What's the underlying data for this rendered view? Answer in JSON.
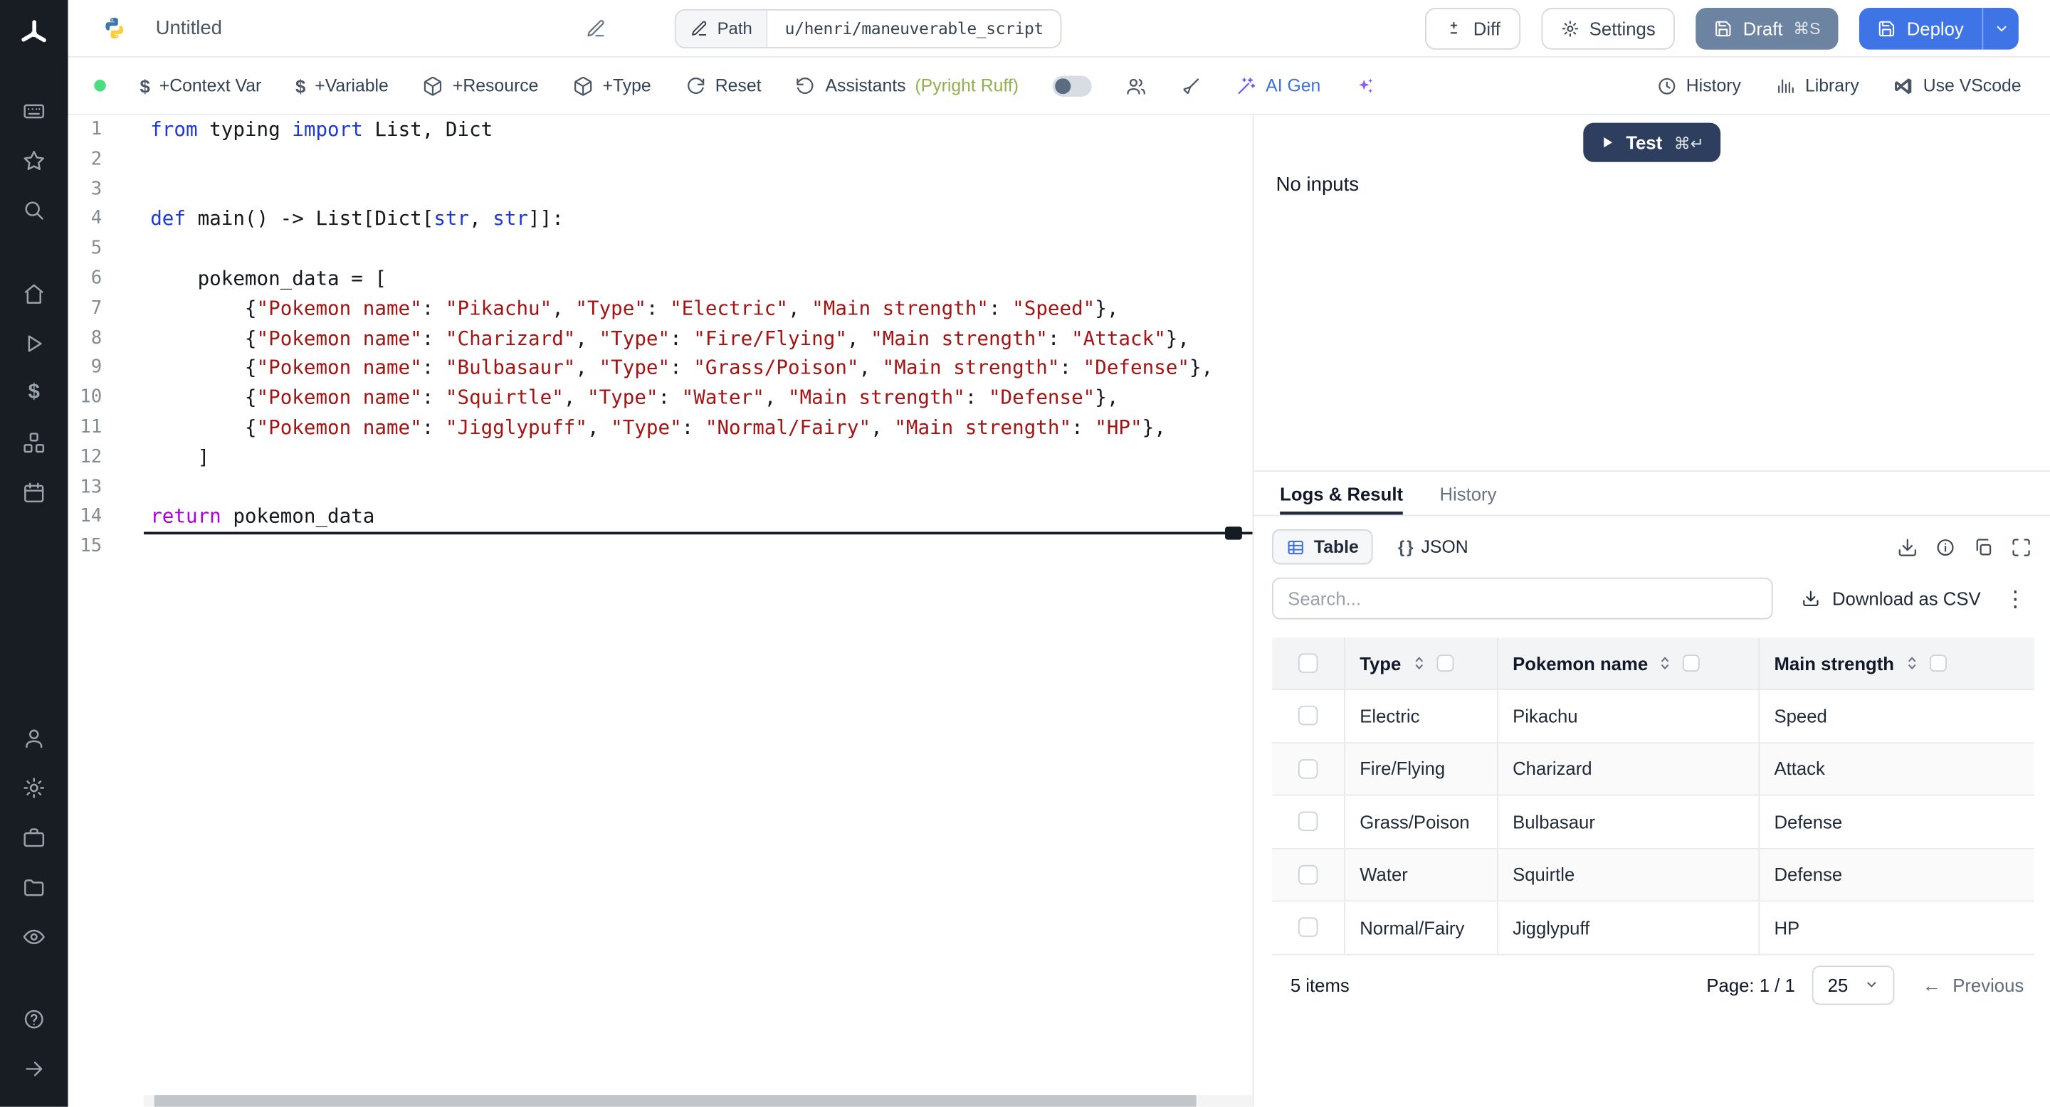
{
  "header": {
    "title": "Untitled",
    "path_label": "Path",
    "path_value": "u/henri/maneuverable_script",
    "diff": "Diff",
    "settings": "Settings",
    "draft": "Draft",
    "draft_shortcut": "⌘S",
    "deploy": "Deploy"
  },
  "toolbar": {
    "context_var": "+Context Var",
    "variable": "+Variable",
    "resource": "+Resource",
    "type": "+Type",
    "reset": "Reset",
    "assistants": "Assistants",
    "assistants_status": "(Pyright Ruff)",
    "ai_gen": "AI Gen",
    "history": "History",
    "library": "Library",
    "use_vscode": "Use VScode"
  },
  "editor": {
    "language": "python",
    "lines": [
      [
        [
          "k",
          "from"
        ],
        [
          "p",
          " typing "
        ],
        [
          "k",
          "import"
        ],
        [
          "p",
          " List, Dict"
        ]
      ],
      [],
      [],
      [
        [
          "k",
          "def"
        ],
        [
          "p",
          " main() -> List[Dict["
        ],
        [
          "t",
          "str"
        ],
        [
          "p",
          ", "
        ],
        [
          "t",
          "str"
        ],
        [
          "p",
          "]]:"
        ]
      ],
      [],
      [
        [
          "p",
          "    pokemon_data = ["
        ]
      ],
      [
        [
          "p",
          "        {"
        ],
        [
          "s",
          "\"Pokemon name\""
        ],
        [
          "p",
          ": "
        ],
        [
          "s",
          "\"Pikachu\""
        ],
        [
          "p",
          ", "
        ],
        [
          "s",
          "\"Type\""
        ],
        [
          "p",
          ": "
        ],
        [
          "s",
          "\"Electric\""
        ],
        [
          "p",
          ", "
        ],
        [
          "s",
          "\"Main strength\""
        ],
        [
          "p",
          ": "
        ],
        [
          "s",
          "\"Speed\""
        ],
        [
          "p",
          "},"
        ]
      ],
      [
        [
          "p",
          "        {"
        ],
        [
          "s",
          "\"Pokemon name\""
        ],
        [
          "p",
          ": "
        ],
        [
          "s",
          "\"Charizard\""
        ],
        [
          "p",
          ", "
        ],
        [
          "s",
          "\"Type\""
        ],
        [
          "p",
          ": "
        ],
        [
          "s",
          "\"Fire/Flying\""
        ],
        [
          "p",
          ", "
        ],
        [
          "s",
          "\"Main strength\""
        ],
        [
          "p",
          ": "
        ],
        [
          "s",
          "\"Attack\""
        ],
        [
          "p",
          "},"
        ]
      ],
      [
        [
          "p",
          "        {"
        ],
        [
          "s",
          "\"Pokemon name\""
        ],
        [
          "p",
          ": "
        ],
        [
          "s",
          "\"Bulbasaur\""
        ],
        [
          "p",
          ", "
        ],
        [
          "s",
          "\"Type\""
        ],
        [
          "p",
          ": "
        ],
        [
          "s",
          "\"Grass/Poison\""
        ],
        [
          "p",
          ", "
        ],
        [
          "s",
          "\"Main strength\""
        ],
        [
          "p",
          ": "
        ],
        [
          "s",
          "\"Defense\""
        ],
        [
          "p",
          "},"
        ]
      ],
      [
        [
          "p",
          "        {"
        ],
        [
          "s",
          "\"Pokemon name\""
        ],
        [
          "p",
          ": "
        ],
        [
          "s",
          "\"Squirtle\""
        ],
        [
          "p",
          ", "
        ],
        [
          "s",
          "\"Type\""
        ],
        [
          "p",
          ": "
        ],
        [
          "s",
          "\"Water\""
        ],
        [
          "p",
          ", "
        ],
        [
          "s",
          "\"Main strength\""
        ],
        [
          "p",
          ": "
        ],
        [
          "s",
          "\"Defense\""
        ],
        [
          "p",
          "},"
        ]
      ],
      [
        [
          "p",
          "        {"
        ],
        [
          "s",
          "\"Pokemon name\""
        ],
        [
          "p",
          ": "
        ],
        [
          "s",
          "\"Jigglypuff\""
        ],
        [
          "p",
          ", "
        ],
        [
          "s",
          "\"Type\""
        ],
        [
          "p",
          ": "
        ],
        [
          "s",
          "\"Normal/Fairy\""
        ],
        [
          "p",
          ", "
        ],
        [
          "s",
          "\"Main strength\""
        ],
        [
          "p",
          ": "
        ],
        [
          "s",
          "\"HP\""
        ],
        [
          "p",
          "},"
        ]
      ],
      [
        [
          "p",
          "    ]"
        ]
      ],
      [],
      [
        [
          "r",
          "return"
        ],
        [
          "p",
          " pokemon_data"
        ]
      ],
      []
    ]
  },
  "run": {
    "test": "Test",
    "test_shortcut": "⌘↵",
    "no_inputs": "No inputs"
  },
  "results": {
    "tabs": [
      "Logs & Result",
      "History"
    ],
    "active_tab": "Logs & Result",
    "views": {
      "table": "Table",
      "json": "JSON"
    },
    "search_placeholder": "Search...",
    "download_csv": "Download as CSV",
    "table": {
      "columns": [
        "Type",
        "Pokemon name",
        "Main strength"
      ],
      "rows": [
        [
          "Electric",
          "Pikachu",
          "Speed"
        ],
        [
          "Fire/Flying",
          "Charizard",
          "Attack"
        ],
        [
          "Grass/Poison",
          "Bulbasaur",
          "Defense"
        ],
        [
          "Water",
          "Squirtle",
          "Defense"
        ],
        [
          "Normal/Fairy",
          "Jigglypuff",
          "HP"
        ]
      ],
      "items_label": "5 items",
      "page_label": "Page: 1 / 1",
      "page_size": "25",
      "previous": "Previous"
    }
  },
  "icons": {
    "kebab": "⋮",
    "dollar": "$",
    "braces": "{ }",
    "arrow_left": "←"
  },
  "colors": {
    "deploy_blue": "#3f74e6",
    "draft_slate": "#6d83a2",
    "test_navy": "#2d3e5e",
    "saved_green": "#4ade80",
    "string_red": "#a31515",
    "keyword_blue": "#1d39d8"
  }
}
